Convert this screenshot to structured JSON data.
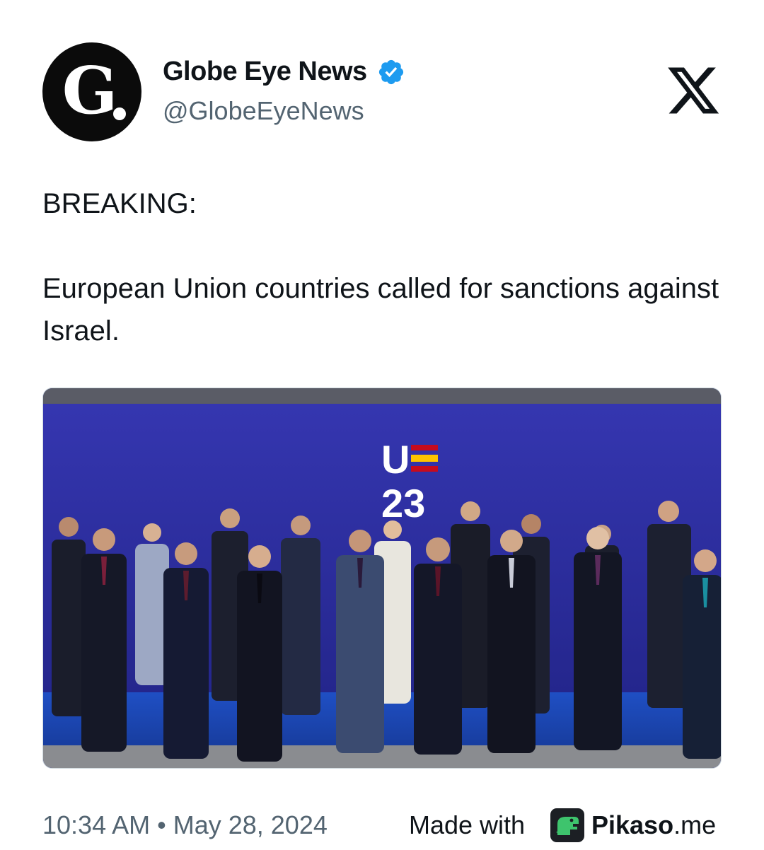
{
  "tweet": {
    "author": {
      "display_name": "Globe Eye News",
      "handle": "@GlobeEyeNews",
      "avatar_letter": "G",
      "verified": true,
      "verified_color": "#1d9bf0"
    },
    "platform_icon": "x-logo-icon",
    "text": {
      "line1": "BREAKING:",
      "line2": "European Union countries called for sanctions against Israel."
    },
    "media": {
      "type": "photo",
      "backdrop_logo_top": "U",
      "backdrop_logo_bottom": "23",
      "backdrop_color": "#2d2fa0",
      "flag_colors": [
        "#c60b1e",
        "#ffc400"
      ]
    },
    "timestamp": "10:34 AM • May 28, 2024"
  },
  "watermark": {
    "made_with": "Made with",
    "brand_bold": "Pikaso",
    "brand_suffix": ".me",
    "icon": "pikaso-dino-icon",
    "icon_color": "#3ec46d"
  }
}
